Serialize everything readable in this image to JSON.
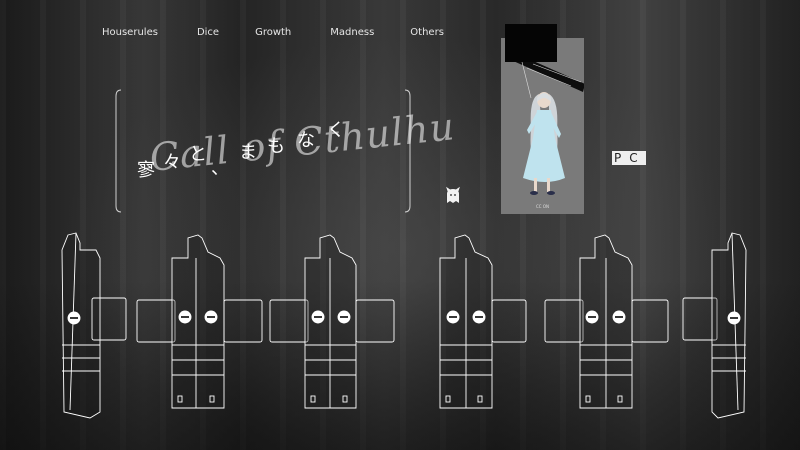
{
  "nav": {
    "items": [
      {
        "label": "Houserules"
      },
      {
        "label": "Dice"
      },
      {
        "label": "Growth"
      },
      {
        "label": "Madness"
      },
      {
        "label": "Others"
      }
    ]
  },
  "title": {
    "japanese_chars": [
      "寥",
      "々",
      "と",
      "、",
      "ま",
      "も",
      "な",
      "く"
    ],
    "script": "Call of Cthulhu"
  },
  "character_card": {
    "caption": "CC ON"
  },
  "pc_button": {
    "label": "PC"
  },
  "colors": {
    "background": "#2a2a2a",
    "line": "#ffffff",
    "card": "#7a7a7a",
    "dress": "#bfe3ee"
  }
}
